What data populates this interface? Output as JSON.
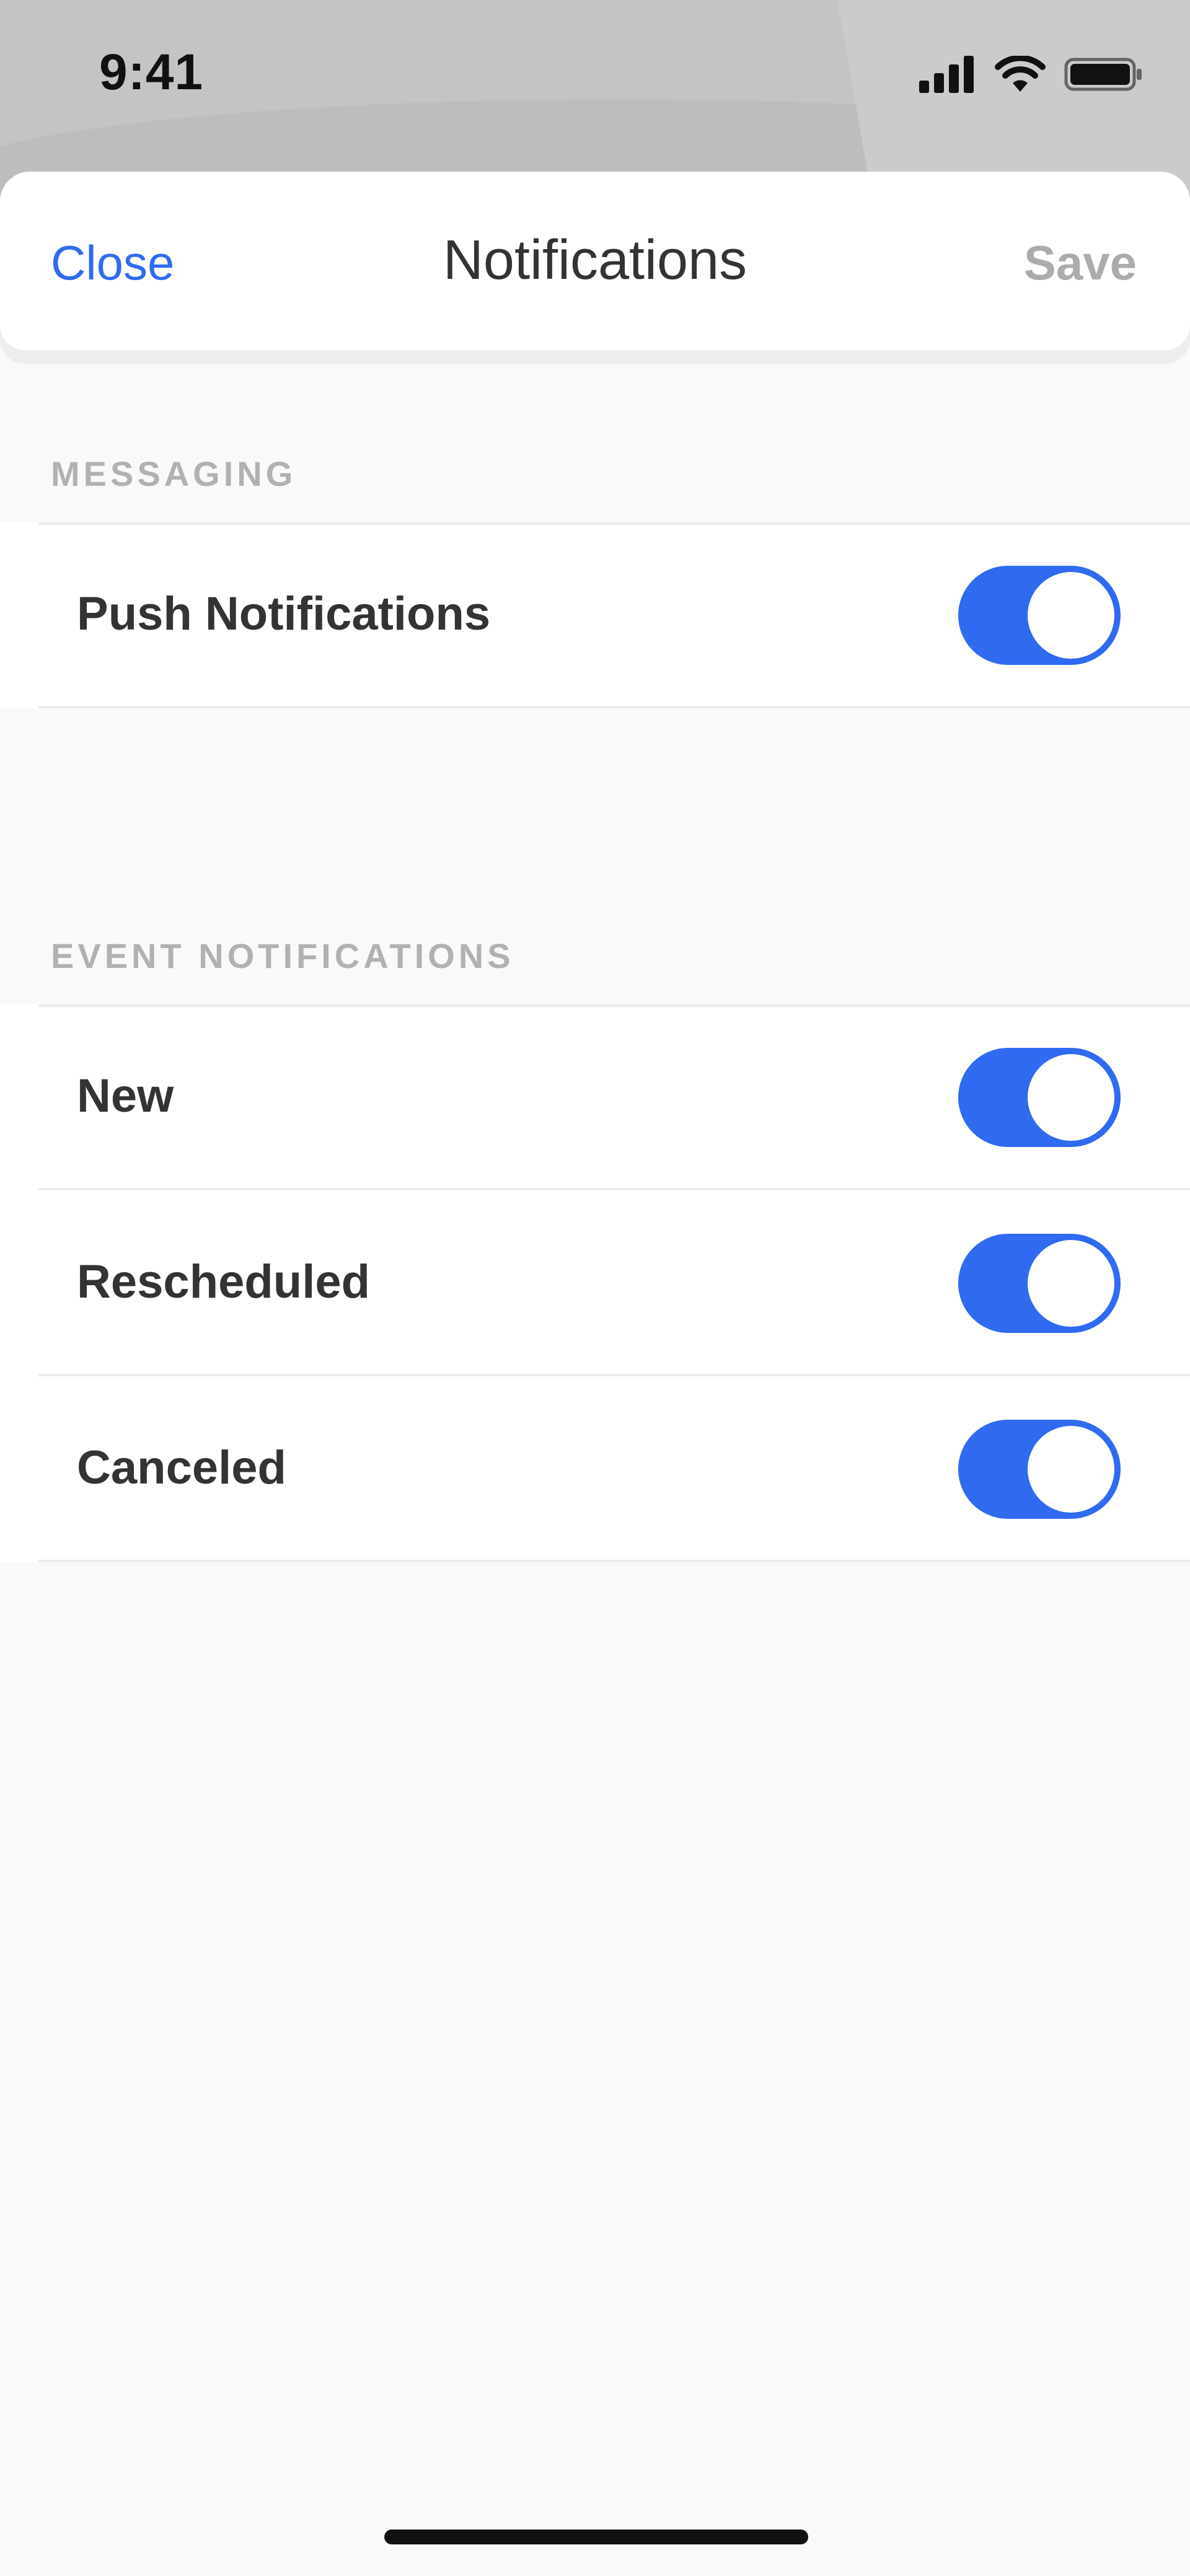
{
  "status_bar": {
    "time": "9:41",
    "icons": [
      "cellular-signal-icon",
      "wifi-icon",
      "battery-icon"
    ]
  },
  "nav": {
    "close_label": "Close",
    "title": "Notifications",
    "save_label": "Save"
  },
  "sections": {
    "messaging": {
      "header": "MESSAGING",
      "items": [
        {
          "label": "Push Notifications",
          "enabled": true
        }
      ]
    },
    "events": {
      "header": "EVENT NOTIFICATIONS",
      "items": [
        {
          "label": "New",
          "enabled": true
        },
        {
          "label": "Rescheduled",
          "enabled": true
        },
        {
          "label": "Canceled",
          "enabled": true
        }
      ]
    }
  },
  "colors": {
    "accent": "#2f6af0",
    "disabled_text": "#ababab",
    "section_header": "#b1b1b1",
    "background": "#f9f9f9"
  }
}
